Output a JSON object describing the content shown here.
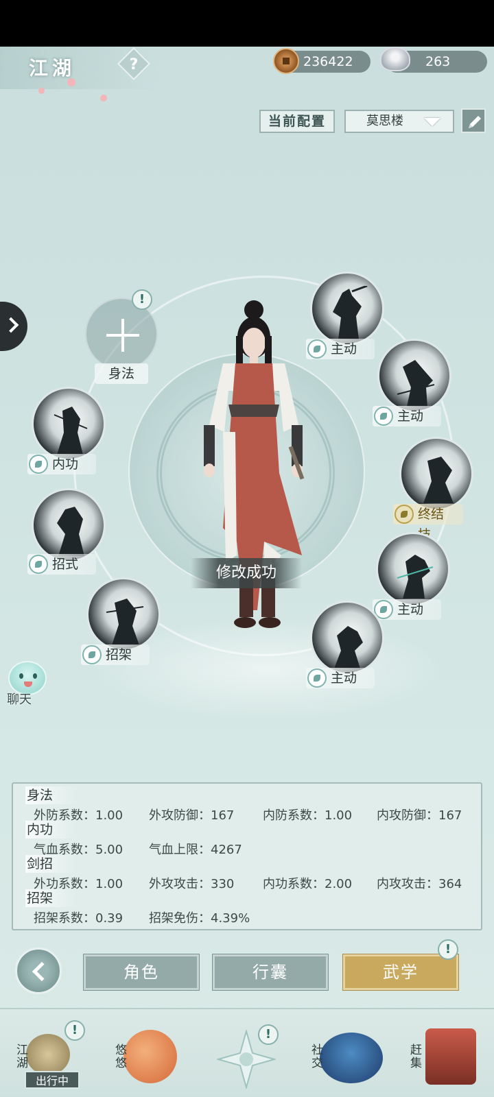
{
  "header": {
    "title": "江湖",
    "help_symbol": "?",
    "copper": "236422",
    "silver": "263"
  },
  "config": {
    "label": "当前配置",
    "selected": "莫思楼"
  },
  "empty_slot": {
    "label": "身法",
    "alert": "!"
  },
  "skills": [
    {
      "label": "主动"
    },
    {
      "label": "主动"
    },
    {
      "label": "终结技"
    },
    {
      "label": "主动"
    },
    {
      "label": "主动"
    },
    {
      "label": "内功"
    },
    {
      "label": "招式"
    },
    {
      "label": "招架"
    }
  ],
  "toast": "修改成功",
  "chat": "聊天",
  "stats": {
    "sections": [
      {
        "title": "身法",
        "cells": [
          "外防系数：1.00",
          "外攻防御：167",
          "内防系数：1.00",
          "内攻防御：167"
        ]
      },
      {
        "title": "内功",
        "cells": [
          "气血系数：5.00",
          "气血上限：4267"
        ]
      },
      {
        "title": "剑招",
        "cells": [
          "外功系数：1.00",
          "外攻攻击：330",
          "内功系数：2.00",
          "内攻攻击：364"
        ]
      },
      {
        "title": "招架",
        "cells": [
          "招架系数：0.39",
          "招架免伤：4.39%"
        ]
      }
    ]
  },
  "tabs": [
    {
      "label": "角色"
    },
    {
      "label": "行囊"
    },
    {
      "label": "武学"
    }
  ],
  "tab_alert": "!",
  "bottom_nav": [
    {
      "label": "江湖",
      "badge": "出行中"
    },
    {
      "label": "悠悠"
    },
    {
      "label": ""
    },
    {
      "label": "社交"
    },
    {
      "label": "赶集"
    }
  ],
  "colors": {
    "active_tab": "#c9a95d",
    "inactive_tab": "#93aaa8",
    "background": "#cfe3e1"
  }
}
